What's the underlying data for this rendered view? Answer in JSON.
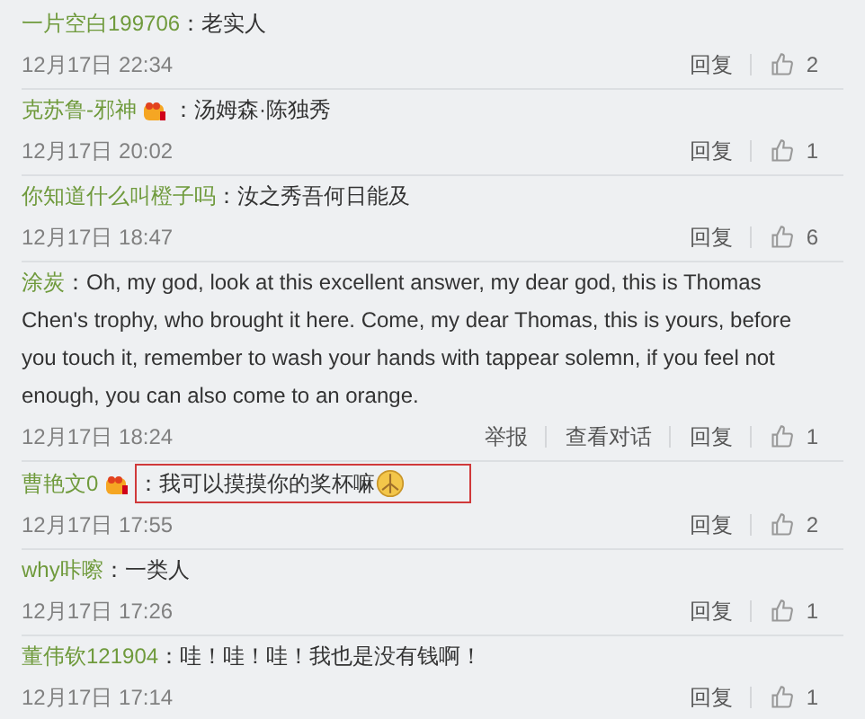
{
  "comments": [
    {
      "user": "一片空白199706",
      "badge": false,
      "text": "：老实人",
      "highlighted": false,
      "emoji": false,
      "time": "12月17日 22:34",
      "actions": [
        "回复"
      ],
      "likes": "2"
    },
    {
      "user": "克苏鲁-邪神",
      "badge": true,
      "text": "：汤姆森·陈独秀",
      "highlighted": false,
      "emoji": false,
      "time": "12月17日 20:02",
      "actions": [
        "回复"
      ],
      "likes": "1"
    },
    {
      "user": "你知道什么叫橙子吗",
      "badge": false,
      "text": "：汝之秀吾何日能及",
      "highlighted": false,
      "emoji": false,
      "time": "12月17日 18:47",
      "actions": [
        "回复"
      ],
      "likes": "6"
    },
    {
      "user": "涂炭",
      "badge": false,
      "text": "：Oh, my god, look at this excellent answer, my dear god, this is Thomas Chen's trophy, who brought it here. Come, my dear Thomas, this is yours, before you touch it, remember to wash your hands with tappear solemn, if you feel not enough, you can also come to an orange.",
      "highlighted": false,
      "emoji": false,
      "time": "12月17日 18:24",
      "actions": [
        "举报",
        "查看对话",
        "回复"
      ],
      "likes": "1"
    },
    {
      "user": "曹艳文0",
      "badge": true,
      "text": "：我可以摸摸你的奖杯嘛",
      "highlighted": true,
      "emoji": true,
      "time": "12月17日 17:55",
      "actions": [
        "回复"
      ],
      "likes": "2"
    },
    {
      "user": "why咔嚓",
      "badge": false,
      "text": "：一类人",
      "highlighted": false,
      "emoji": false,
      "time": "12月17日 17:26",
      "actions": [
        "回复"
      ],
      "likes": "1"
    },
    {
      "user": "董伟钦121904",
      "badge": false,
      "text": "：哇！哇！哇！我也是没有钱啊！",
      "highlighted": false,
      "emoji": false,
      "time": "12月17日 17:14",
      "actions": [
        "回复"
      ],
      "likes": "1"
    }
  ]
}
